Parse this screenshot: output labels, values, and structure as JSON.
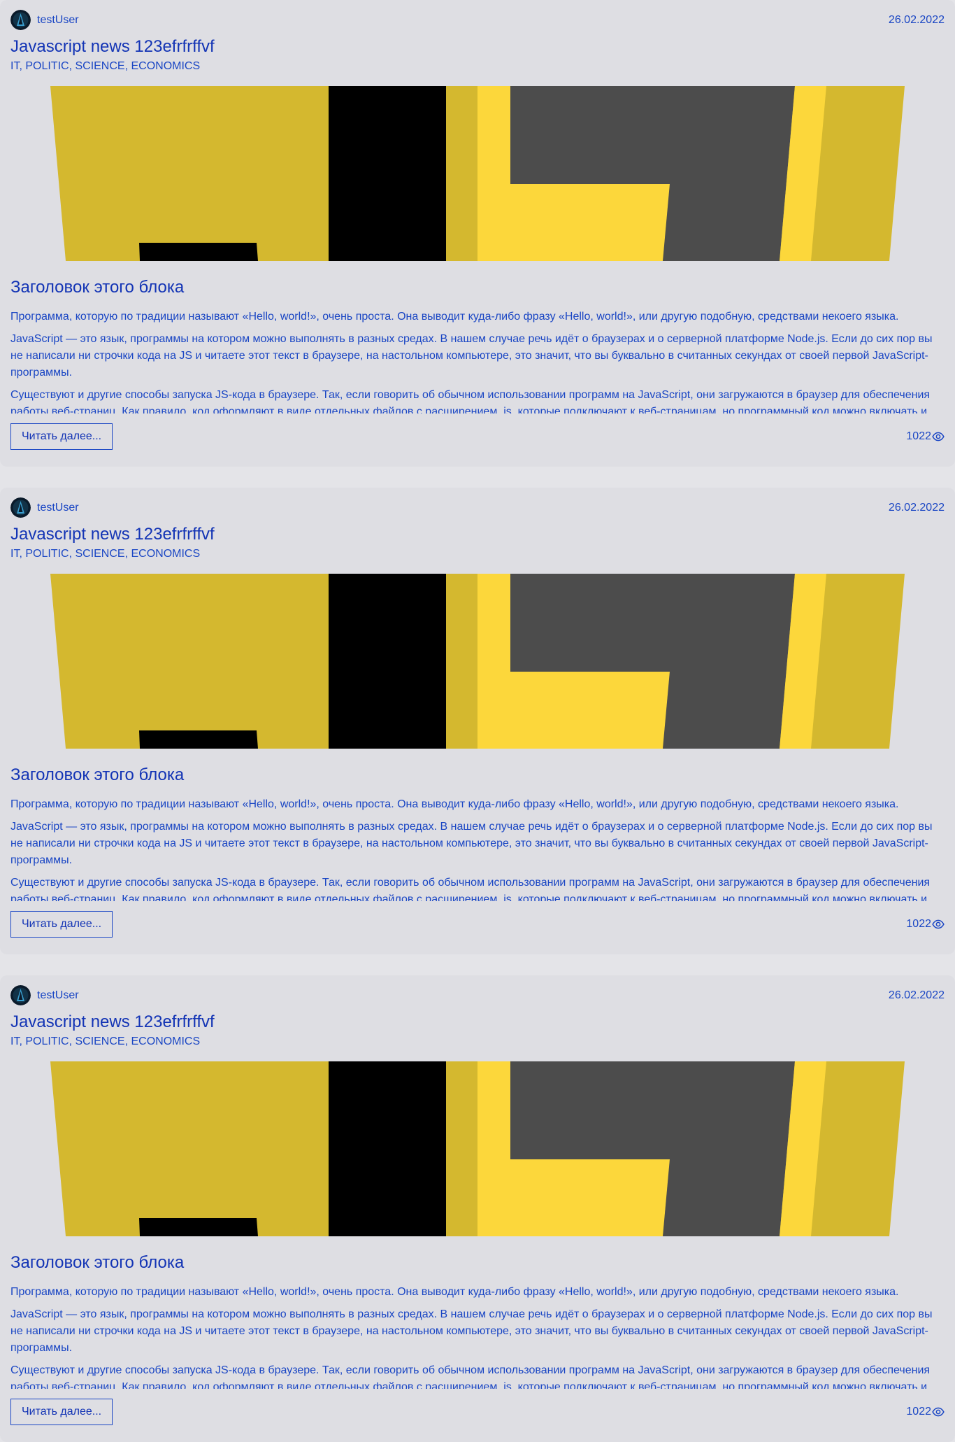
{
  "colors": {
    "page_background": "#e4e4e8",
    "card_background": "#dedee3",
    "text_accent": "#1a46c4",
    "title_accent": "#1334b5",
    "banner_yellow": "#d4b82f",
    "banner_bright_yellow": "#fcd73b",
    "banner_gray": "#4c4c4c"
  },
  "posts": [
    {
      "author": "testUser",
      "avatar_icon": "user-avatar-icon",
      "date": "26.02.2022",
      "title": "Javascript news 123efrfrffvf",
      "tags": "IT, POLITIC, SCIENCE, ECONOMICS",
      "banner_icon": "javascript-logo-banner",
      "block_title": "Заголовок этого блока",
      "paragraphs": [
        "Программа, которую по традиции называют «Hello, world!», очень проста. Она выводит куда-либо фразу «Hello, world!», или другую подобную, средствами некоего языка.",
        "JavaScript — это язык, программы на котором можно выполнять в разных средах. В нашем случае речь идёт о браузерах и о серверной платформе Node.js. Если до сих пор вы не написали ни строчки кода на JS и читаете этот текст в браузере, на настольном компьютере, это значит, что вы буквально в считанных секундах от своей первой JavaScript-программы.",
        "Существуют и другие способы запуска JS-кода в браузере. Так, если говорить об обычном использовании программ на JavaScript, они загружаются в браузер для обеспечения работы веб-страниц. Как правило, код оформляют в виде отдельных файлов с расширением .js, которые подключают к веб-страницам, но программный код можно включать и"
      ],
      "read_more_label": "Читать далее...",
      "views": "1022",
      "views_icon": "eye-icon"
    },
    {
      "author": "testUser",
      "avatar_icon": "user-avatar-icon",
      "date": "26.02.2022",
      "title": "Javascript news 123efrfrffvf",
      "tags": "IT, POLITIC, SCIENCE, ECONOMICS",
      "banner_icon": "javascript-logo-banner",
      "block_title": "Заголовок этого блока",
      "paragraphs": [
        "Программа, которую по традиции называют «Hello, world!», очень проста. Она выводит куда-либо фразу «Hello, world!», или другую подобную, средствами некоего языка.",
        "JavaScript — это язык, программы на котором можно выполнять в разных средах. В нашем случае речь идёт о браузерах и о серверной платформе Node.js. Если до сих пор вы не написали ни строчки кода на JS и читаете этот текст в браузере, на настольном компьютере, это значит, что вы буквально в считанных секундах от своей первой JavaScript-программы.",
        "Существуют и другие способы запуска JS-кода в браузере. Так, если говорить об обычном использовании программ на JavaScript, они загружаются в браузер для обеспечения работы веб-страниц. Как правило, код оформляют в виде отдельных файлов с расширением .js, которые подключают к веб-страницам, но программный код можно включать и"
      ],
      "read_more_label": "Читать далее...",
      "views": "1022",
      "views_icon": "eye-icon"
    },
    {
      "author": "testUser",
      "avatar_icon": "user-avatar-icon",
      "date": "26.02.2022",
      "title": "Javascript news 123efrfrffvf",
      "tags": "IT, POLITIC, SCIENCE, ECONOMICS",
      "banner_icon": "javascript-logo-banner",
      "block_title": "Заголовок этого блока",
      "paragraphs": [
        "Программа, которую по традиции называют «Hello, world!», очень проста. Она выводит куда-либо фразу «Hello, world!», или другую подобную, средствами некоего языка.",
        "JavaScript — это язык, программы на котором можно выполнять в разных средах. В нашем случае речь идёт о браузерах и о серверной платформе Node.js. Если до сих пор вы не написали ни строчки кода на JS и читаете этот текст в браузере, на настольном компьютере, это значит, что вы буквально в считанных секундах от своей первой JavaScript-программы.",
        "Существуют и другие способы запуска JS-кода в браузере. Так, если говорить об обычном использовании программ на JavaScript, они загружаются в браузер для обеспечения работы веб-страниц. Как правило, код оформляют в виде отдельных файлов с расширением .js, которые подключают к веб-страницам, но программный код можно включать и"
      ],
      "read_more_label": "Читать далее...",
      "views": "1022",
      "views_icon": "eye-icon"
    }
  ]
}
